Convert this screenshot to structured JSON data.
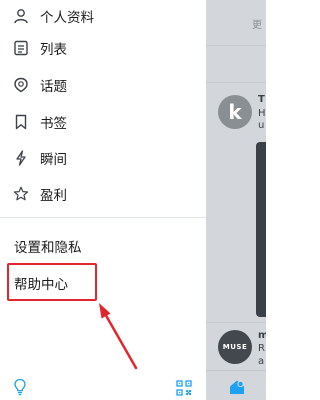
{
  "menu": {
    "items": [
      {
        "label": "个人资料",
        "icon": "person-icon"
      },
      {
        "label": "列表",
        "icon": "list-icon"
      },
      {
        "label": "话题",
        "icon": "topic-icon"
      },
      {
        "label": "书签",
        "icon": "bookmark-icon"
      },
      {
        "label": "瞬间",
        "icon": "lightning-icon"
      },
      {
        "label": "盈利",
        "icon": "star-icon"
      }
    ],
    "settings_label": "设置和隐私",
    "help_label": "帮助中心"
  },
  "bottom": {
    "left_icon": "lightbulb-icon",
    "right_icon": "qr-code-icon"
  },
  "backdrop": {
    "top_text": "更",
    "tweet1": {
      "avatar_letter": "k",
      "line1": "T",
      "line2": "H",
      "line3": "u"
    },
    "tweet2": {
      "avatar_text": "MUSE",
      "line1": "m",
      "line2": "R",
      "line3": "a"
    }
  },
  "colors": {
    "accent": "#1da1f2",
    "highlight": "#e3262e",
    "text": "#1c1c1c"
  }
}
